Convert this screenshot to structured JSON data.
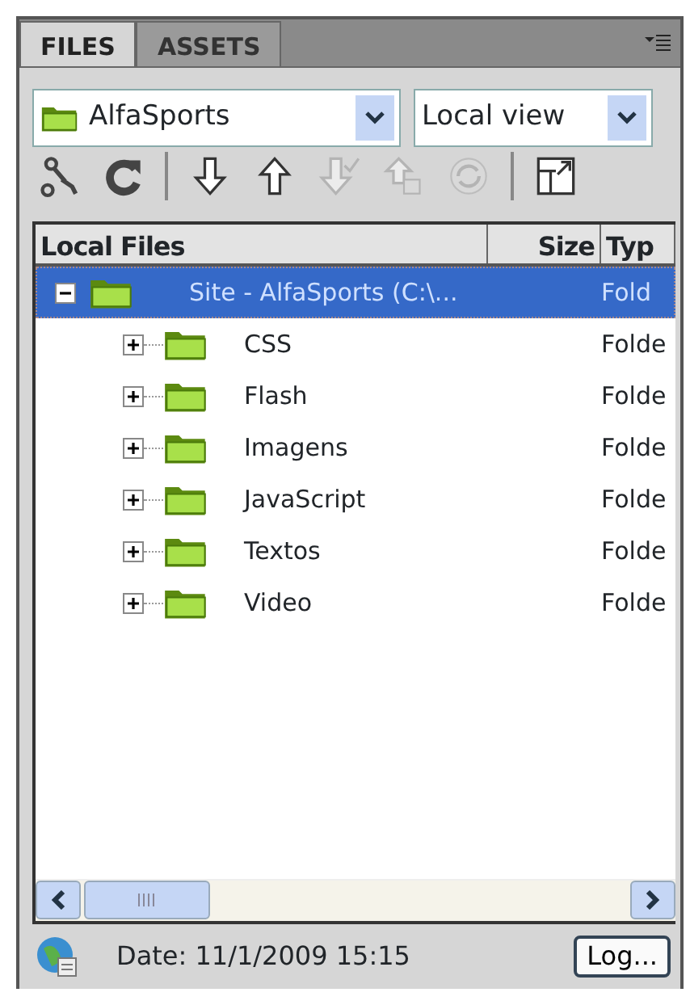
{
  "tabs": [
    {
      "label": "FILES",
      "selected": true
    },
    {
      "label": "ASSETS",
      "selected": false
    }
  ],
  "site_select": {
    "value": "AlfaSports"
  },
  "view_select": {
    "value": "Local view"
  },
  "toolbar": [
    {
      "kind": "connect",
      "disabled": false
    },
    {
      "kind": "refresh",
      "disabled": false
    },
    {
      "kind": "separator"
    },
    {
      "kind": "get",
      "disabled": false
    },
    {
      "kind": "put",
      "disabled": false
    },
    {
      "kind": "checkout",
      "disabled": true
    },
    {
      "kind": "checkin",
      "disabled": true
    },
    {
      "kind": "sync",
      "disabled": true
    },
    {
      "kind": "separator"
    },
    {
      "kind": "expand",
      "disabled": false
    }
  ],
  "table": {
    "columns": [
      "Local Files",
      "Size",
      "Typ"
    ],
    "rows": [
      {
        "name": "Site - AlfaSports (C:\\...",
        "type": "Fold",
        "expanded": true,
        "selected": true,
        "children": [
          {
            "name": "CSS",
            "type": "Folde",
            "expanded": false,
            "selected": false
          },
          {
            "name": "Flash",
            "type": "Folde",
            "expanded": false,
            "selected": false
          },
          {
            "name": "Imagens",
            "type": "Folde",
            "expanded": false,
            "selected": false
          },
          {
            "name": "JavaScript",
            "type": "Folde",
            "expanded": false,
            "selected": false
          },
          {
            "name": "Textos",
            "type": "Folde",
            "expanded": false,
            "selected": false
          },
          {
            "name": "Video",
            "type": "Folde",
            "expanded": false,
            "selected": false
          }
        ]
      }
    ]
  },
  "status_bar": {
    "date": "Date: 11/1/2009 15:15",
    "log_button": "Log..."
  }
}
